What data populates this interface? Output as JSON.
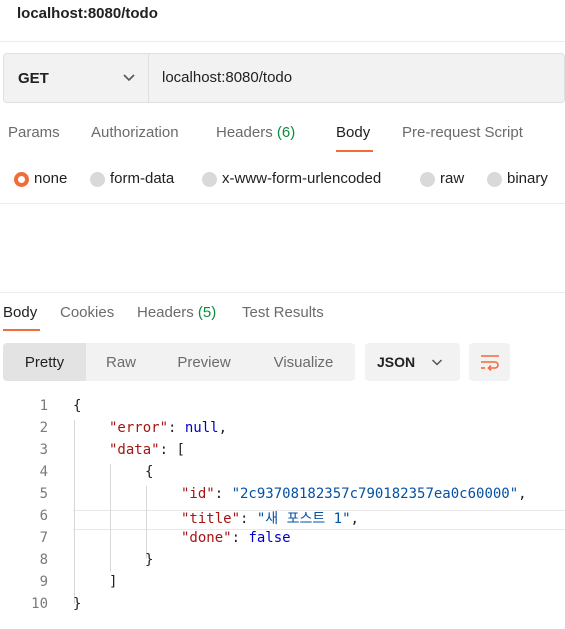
{
  "window": {
    "title": "localhost:8080/todo"
  },
  "request": {
    "method": "GET",
    "url": "localhost:8080/todo"
  },
  "request_tabs": [
    {
      "label": "Params"
    },
    {
      "label": "Authorization"
    },
    {
      "label": "Headers",
      "count": "(6)"
    },
    {
      "label": "Body",
      "active": true
    },
    {
      "label": "Pre-request Script"
    }
  ],
  "body_types": [
    {
      "label": "none",
      "selected": true
    },
    {
      "label": "form-data"
    },
    {
      "label": "x-www-form-urlencoded"
    },
    {
      "label": "raw"
    },
    {
      "label": "binary"
    }
  ],
  "response_tabs": [
    {
      "label": "Body",
      "active": true
    },
    {
      "label": "Cookies"
    },
    {
      "label": "Headers",
      "count": "(5)"
    },
    {
      "label": "Test Results"
    }
  ],
  "view_modes": [
    {
      "label": "Pretty",
      "active": true
    },
    {
      "label": "Raw"
    },
    {
      "label": "Preview"
    },
    {
      "label": "Visualize"
    }
  ],
  "format": {
    "selected": "JSON"
  },
  "icons": {
    "method_dropdown": "chevron-down-icon",
    "format_dropdown": "chevron-down-icon",
    "wrap": "wrap-lines-icon"
  },
  "colors": {
    "accent": "#f26b3a",
    "count_green": "#0d8a3d",
    "json_key": "#a31515",
    "json_string": "#0451a5",
    "json_keyword": "#0000cc"
  },
  "response_body": {
    "line_numbers": [
      "1",
      "2",
      "3",
      "4",
      "5",
      "6",
      "7",
      "8",
      "9",
      "10"
    ],
    "lines": [
      {
        "text": "{"
      },
      {
        "key": "\"error\"",
        "sep": ": ",
        "value": "null",
        "vtype": "kw",
        "tail": ","
      },
      {
        "key": "\"data\"",
        "sep": ": ",
        "value": "[",
        "vtype": "plain",
        "tail": ""
      },
      {
        "text": "{"
      },
      {
        "key": "\"id\"",
        "sep": ": ",
        "value": "\"2c93708182357c790182357ea0c60000\"",
        "vtype": "s",
        "tail": ","
      },
      {
        "key": "\"title\"",
        "sep": ": ",
        "value": "\"새 포스트 1\"",
        "vtype": "s",
        "tail": ","
      },
      {
        "key": "\"done\"",
        "sep": ": ",
        "value": "false",
        "vtype": "kw",
        "tail": ""
      },
      {
        "text": "}"
      },
      {
        "text": "]"
      },
      {
        "text": "}"
      }
    ]
  }
}
